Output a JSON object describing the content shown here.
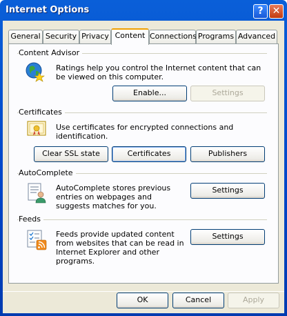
{
  "window": {
    "title": "Internet Options"
  },
  "titlebar": {
    "help_glyph": "?",
    "close_glyph": "✕"
  },
  "tabs": [
    "General",
    "Security",
    "Privacy",
    "Content",
    "Connections",
    "Programs",
    "Advanced"
  ],
  "active_tab": "Content",
  "content_advisor": {
    "title": "Content Advisor",
    "description": "Ratings help you control the Internet content that can be viewed on this computer.",
    "enable_label": "Enable...",
    "settings_label": "Settings",
    "icon": "globe-star-icon"
  },
  "certificates": {
    "title": "Certificates",
    "description": "Use certificates for encrypted connections and identification.",
    "clear_ssl_label": "Clear SSL state",
    "certificates_label": "Certificates",
    "publishers_label": "Publishers",
    "icon": "certificate-icon"
  },
  "autocomplete": {
    "title": "AutoComplete",
    "description": "AutoComplete stores previous entries on webpages and suggests matches for you.",
    "settings_label": "Settings",
    "icon": "autocomplete-icon"
  },
  "feeds": {
    "title": "Feeds",
    "description": "Feeds provide updated content from websites that can be read in Internet Explorer and other programs.",
    "settings_label": "Settings",
    "icon": "feed-icon"
  },
  "footer": {
    "ok_label": "OK",
    "cancel_label": "Cancel",
    "apply_label": "Apply"
  },
  "colors": {
    "titlebar": "#0046c8",
    "dialog_bg": "#ece9d8",
    "panel_bg": "#fcfcfe",
    "active_tab_accent": "#f0a000"
  }
}
